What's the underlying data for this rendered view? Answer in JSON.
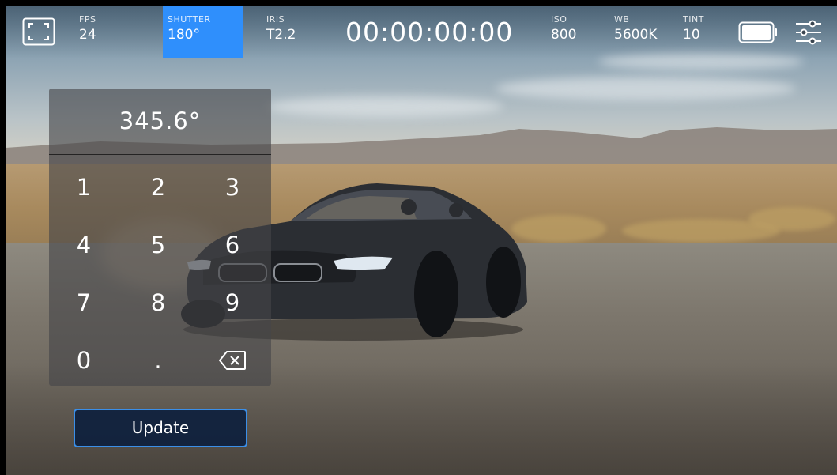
{
  "topbar": {
    "fps": {
      "label": "FPS",
      "value": "24"
    },
    "shutter": {
      "label": "SHUTTER",
      "value": "180°"
    },
    "iris": {
      "label": "IRIS",
      "value": "T2.2"
    },
    "timecode": "00:00:00:00",
    "iso": {
      "label": "ISO",
      "value": "800"
    },
    "wb": {
      "label": "WB",
      "value": "5600K"
    },
    "tint": {
      "label": "TINT",
      "value": "10"
    },
    "icons": [
      "fullscreen-icon",
      "battery-icon",
      "settings-sliders-icon"
    ]
  },
  "keypad": {
    "display": "345.6°",
    "keys": [
      "1",
      "2",
      "3",
      "4",
      "5",
      "6",
      "7",
      "8",
      "9",
      "0",
      ".",
      "backspace"
    ]
  },
  "update_button": "Update",
  "colors": {
    "accent": "#2f8ffc",
    "button_border": "#3b8fe8"
  }
}
